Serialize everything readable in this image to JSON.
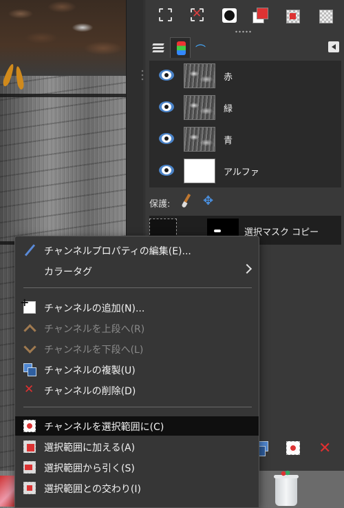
{
  "channels": {
    "items": [
      {
        "name": "赤"
      },
      {
        "name": "緑"
      },
      {
        "name": "青"
      },
      {
        "name": "アルファ"
      }
    ],
    "lock_label": "保護:",
    "mask_name": "選択マスク コピー"
  },
  "context_menu": {
    "items": [
      {
        "label": "チャンネルプロパティの編集(E)...",
        "icon": "pencil-icon",
        "enabled": true
      },
      {
        "label": "カラータグ",
        "icon": "",
        "enabled": true,
        "submenu": true
      },
      {
        "label": "チャンネルの追加(N)...",
        "icon": "new-channel-icon",
        "enabled": true
      },
      {
        "label": "チャンネルを上段へ(R)",
        "icon": "arrow-up-icon",
        "enabled": false
      },
      {
        "label": "チャンネルを下段へ(L)",
        "icon": "arrow-down-icon",
        "enabled": false
      },
      {
        "label": "チャンネルの複製(U)",
        "icon": "duplicate-icon",
        "enabled": true
      },
      {
        "label": "チャンネルの削除(D)",
        "icon": "delete-icon",
        "enabled": true
      },
      {
        "label": "チャンネルを選択範囲に(C)",
        "icon": "channel-to-selection-icon",
        "enabled": true,
        "highlighted": true
      },
      {
        "label": "選択範囲に加える(A)",
        "icon": "add-to-selection-icon",
        "enabled": true
      },
      {
        "label": "選択範囲から引く(S)",
        "icon": "subtract-from-selection-icon",
        "enabled": true
      },
      {
        "label": "選択範囲との交わり(I)",
        "icon": "intersect-selection-icon",
        "enabled": true
      }
    ]
  },
  "colors": {
    "delete_red": "#e03030",
    "eye_blue": "#4a83c8",
    "menu_bg": "#363636",
    "highlight_bg": "#0f0f0f"
  }
}
